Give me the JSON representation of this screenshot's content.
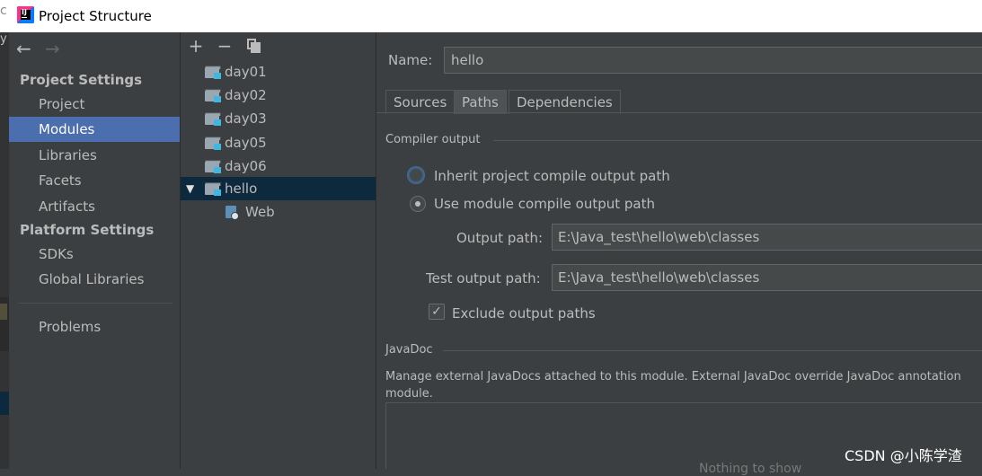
{
  "window": {
    "title": "Project Structure"
  },
  "nav": {
    "back_glyph": "←",
    "forward_glyph": "→",
    "project_settings_heading": "Project Settings",
    "platform_settings_heading": "Platform Settings",
    "items": {
      "project": "Project",
      "modules": "Modules",
      "libraries": "Libraries",
      "facets": "Facets",
      "artifacts": "Artifacts",
      "sdks": "SDKs",
      "global_libraries": "Global Libraries",
      "problems": "Problems"
    },
    "selected": "Modules"
  },
  "tree": {
    "toolbar": {
      "add": "+",
      "remove": "−"
    },
    "modules": [
      "day01",
      "day02",
      "day03",
      "day05",
      "day06",
      "hello"
    ],
    "expander_glyph": "▼",
    "child": "Web",
    "selected": "hello"
  },
  "module": {
    "name_label": "Name:",
    "name_value": "hello",
    "tabs": [
      "Sources",
      "Paths",
      "Dependencies"
    ],
    "active_tab": "Paths",
    "compiler_output": {
      "title": "Compiler output",
      "inherit_label": "Inherit project compile output path",
      "use_module_label": "Use module compile output path",
      "output_path_label": "Output path:",
      "output_path": "E:\\Java_test\\hello\\web\\classes",
      "test_output_path_label": "Test output path:",
      "test_output_path": "E:\\Java_test\\hello\\web\\classes",
      "exclude_label": "Exclude output paths",
      "exclude_checked": true,
      "check_glyph": "✓"
    },
    "javadoc": {
      "title": "JavaDoc",
      "description_line1": "Manage external JavaDocs attached to this module. External JavaDoc override JavaDoc annotation",
      "description_line2": "module.",
      "empty_text": "Nothing to show"
    }
  },
  "watermark": "CSDN @小陈学渣",
  "colors": {
    "background": "#3c3f41",
    "selection": "#4b6eaf",
    "tree_selection": "#0d293e",
    "text": "#bbbbbb"
  }
}
